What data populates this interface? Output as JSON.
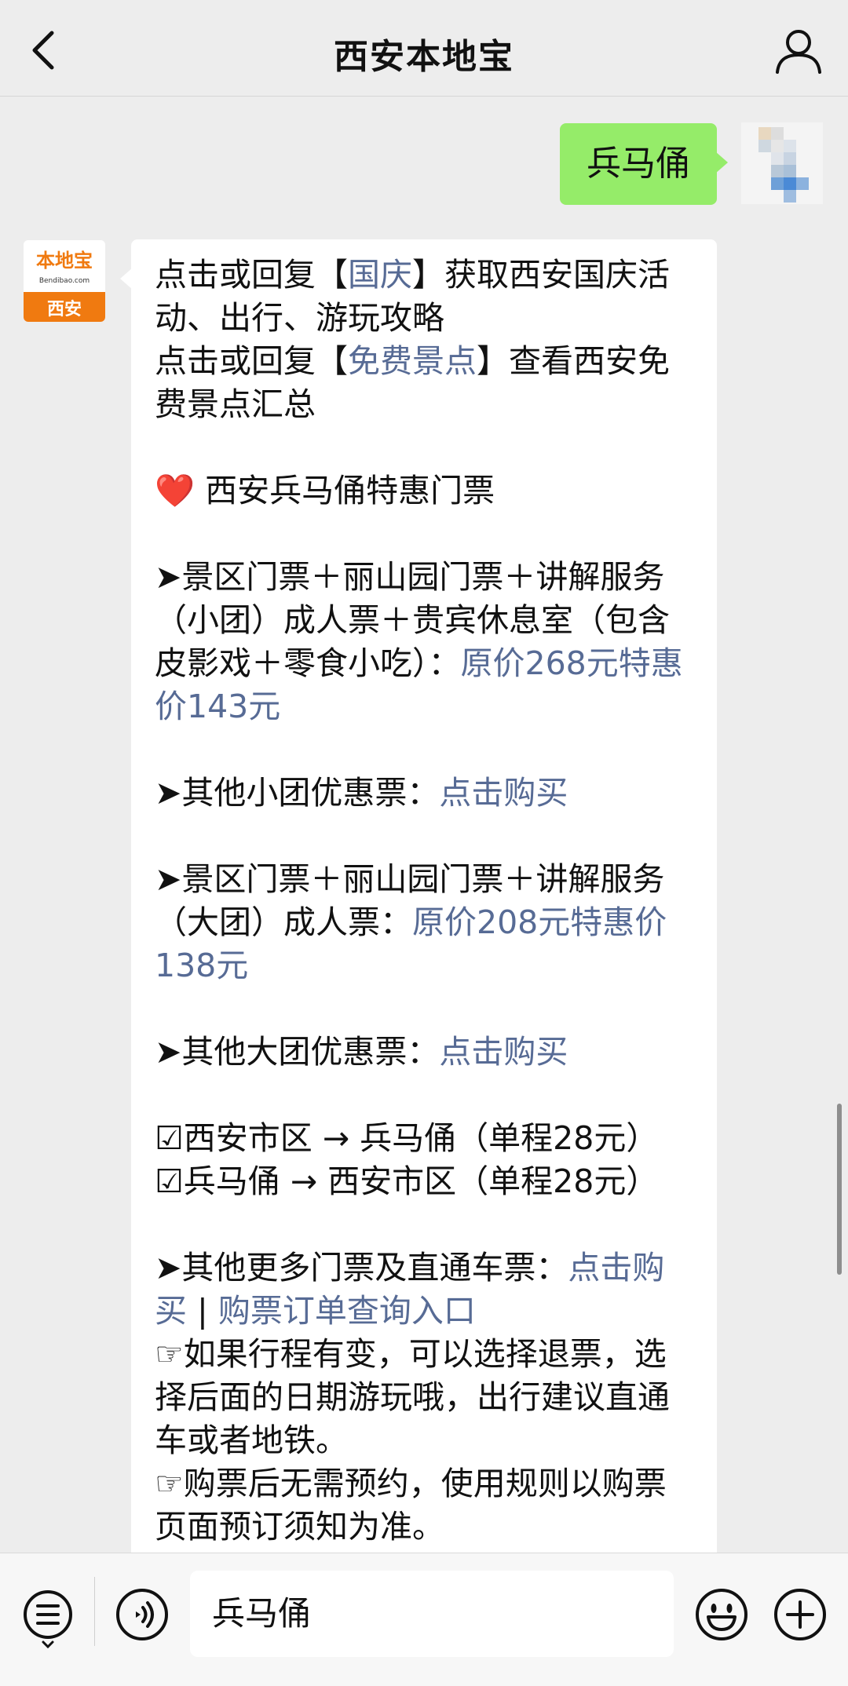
{
  "header": {
    "title": "西安本地宝"
  },
  "user_message": {
    "text": "兵马俑"
  },
  "bot_avatar": {
    "brand_text": "本地宝",
    "brand_url": "Bendibao.com",
    "city": "西安"
  },
  "bot_message": {
    "l1a": "点击或回复【",
    "l1b": "国庆",
    "l1c": "】获取西安国庆活动、出行、游玩攻略",
    "l2a": "点击或回复【",
    "l2b": "免费景点",
    "l2c": "】查看西安免费景点汇总",
    "heart": "❤️",
    "section_title": "西安兵马俑特惠门票",
    "t1": "➤景区门票＋丽山园门票＋讲解服务（小团）成人票＋贵宾休息室（包含皮影戏＋零食小吃）：",
    "t1_price": "原价268元特惠价143元",
    "t2": "➤其他小团优惠票：",
    "t2_link": "点击购买",
    "t3": "➤景区门票＋丽山园门票＋讲解服务（大团）成人票：",
    "t3_price": "原价208元特惠价138元",
    "t4": "➤其他大团优惠票：",
    "t4_link": "点击购买",
    "bus1": "☑西安市区 → 兵马俑（单程28元）",
    "bus2": "☑兵马俑 → 西安市区（单程28元）",
    "t5": "➤其他更多门票及直通车票：",
    "t5_link1": "点击购买",
    "t5_sep": " | ",
    "t5_link2": "购票订单查询入口",
    "note1": "☞如果行程有变，可以选择退票，选择后面的日期游玩哦，出行建议直通车或者地铁。",
    "note2": "☞购票后无需预约，使用规则以购票页面预订须知为准。"
  },
  "input_bar": {
    "text_value": "兵马俑"
  },
  "colors": {
    "background": "#ededed",
    "user_bubble": "#95ec69",
    "link": "#576b95",
    "brand_orange": "#f07a10"
  }
}
